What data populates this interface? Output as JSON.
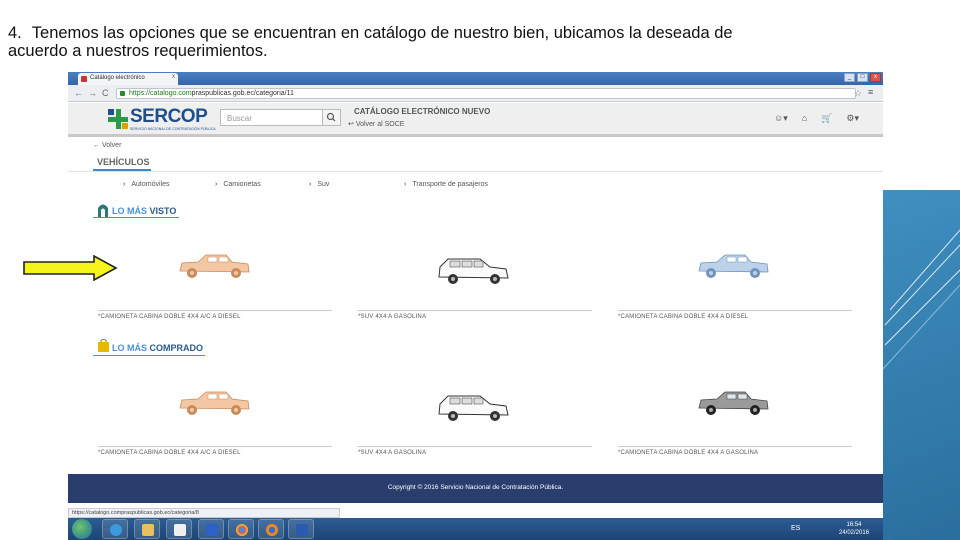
{
  "slide": {
    "number": "4.",
    "text_line1": "Tenemos las opciones que se encuentran en catálogo de nuestro bien, ubicamos la deseada de",
    "text_line2": "acuerdo a nuestros requerimientos.",
    "colors": {
      "arrow_fill": "#f5f51a",
      "band": "#2a6f9e"
    }
  },
  "browser": {
    "tab_title": "Catálogo electrónico",
    "tab_close": "x",
    "window_buttons": [
      "_",
      "□",
      "x"
    ],
    "nav": {
      "back": "←",
      "forward": "→",
      "reload": "C"
    },
    "url_secure": "https://catalogo.com",
    "url_rest": "praspublicas.gob.ec/categoria/11",
    "star": "☆",
    "menu": "≡",
    "status_url": "https://catalogo.compraspublicas.gob.ec/categoria/8"
  },
  "site": {
    "logo": "SERCOP",
    "logo_sub": "SERVICIO NACIONAL DE CONTRATACIÓN PÚBLICA",
    "search_placeholder": "Buscar",
    "catalog_title": "CATÁLOGO ELECTRÓNICO NUEVO",
    "back_soce": "Volver al SOCE",
    "back": "Volver",
    "section": "VEHÍCULOS",
    "categories": [
      "Automóviles",
      "Camionetas",
      "Suv",
      "Transporte de pasajeros"
    ],
    "most_viewed": {
      "part1": "LO MÁS",
      "part2": "VISTO"
    },
    "most_bought": {
      "part1": "LO MÁS",
      "part2": "COMPRADO"
    },
    "viewed_items": [
      {
        "label": "*CAMIONETA CABINA DOBLE 4X4 A/C A DIESEL",
        "icon": "pickup-truck-orange"
      },
      {
        "label": "*SUV 4X4 A GASOLINA",
        "icon": "suv-white"
      },
      {
        "label": "*CAMIONETA CABINA DOBLE 4X4 A DIESEL",
        "icon": "pickup-truck-blue"
      }
    ],
    "bought_items": [
      {
        "label": "*CAMIONETA CABINA DOBLE 4X4 A/C A DIESEL",
        "icon": "pickup-truck-orange"
      },
      {
        "label": "*SUV 4X4 A GASOLINA",
        "icon": "suv-white"
      },
      {
        "label": "*CAMIONETA CABINA DOBLE 4X4 A GASOLINA",
        "icon": "pickup-truck-gray"
      }
    ],
    "footer": "Copyright © 2016 Servicio Nacional de Contratación Pública."
  },
  "taskbar": {
    "time": "16:54",
    "date": "24/02/2016",
    "tray": "ES"
  }
}
